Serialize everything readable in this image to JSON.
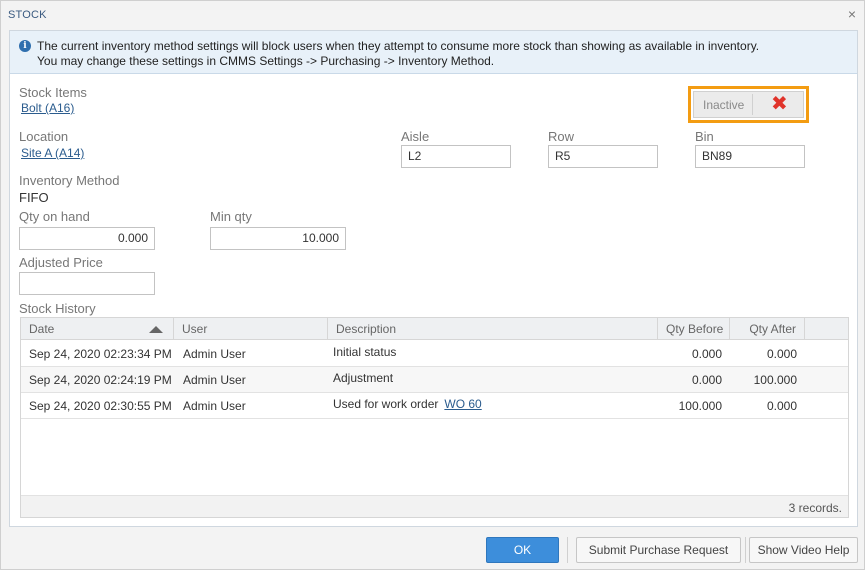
{
  "dialog": {
    "title": "STOCK",
    "close_glyph": "×"
  },
  "info": {
    "icon": "info-icon",
    "line1": "The current inventory method settings will block users when they attempt to consume more stock than showing as available in inventory.",
    "line2": "You may change these settings in CMMS Settings -> Purchasing -> Inventory Method."
  },
  "form": {
    "stock_items_label": "Stock Items",
    "stock_item_value": "Bolt (A16)",
    "status_toggle_label": "Inactive",
    "status_toggle_icon": "✖",
    "location_label": "Location",
    "location_value": "Site A (A14)",
    "aisle_label": "Aisle",
    "aisle_value": "L2",
    "row_label": "Row",
    "row_value": "R5",
    "bin_label": "Bin",
    "bin_value": "BN89",
    "inventory_method_label": "Inventory Method",
    "inventory_method_value": "FIFO",
    "qty_on_hand_label": "Qty on hand",
    "qty_on_hand_value": "0.000",
    "min_qty_label": "Min qty",
    "min_qty_value": "10.000",
    "adjusted_price_label": "Adjusted Price",
    "adjusted_price_value": ""
  },
  "history": {
    "label": "Stock History",
    "columns": [
      "Date",
      "User",
      "Description",
      "Qty Before",
      "Qty After"
    ],
    "rows": [
      {
        "date": "Sep 24, 2020 02:23:34 PM",
        "user": "Admin User",
        "description": "Initial status",
        "link": "",
        "qty_before": "0.000",
        "qty_after": "0.000"
      },
      {
        "date": "Sep 24, 2020 02:24:19 PM",
        "user": "Admin User",
        "description": "Adjustment",
        "link": "",
        "qty_before": "0.000",
        "qty_after": "100.000"
      },
      {
        "date": "Sep 24, 2020 02:30:55 PM",
        "user": "Admin User",
        "description": "Used for work order",
        "link": "WO 60",
        "qty_before": "100.000",
        "qty_after": "0.000"
      }
    ],
    "records_text": "3 records."
  },
  "buttons": {
    "ok": "OK",
    "submit_purchase_request": "Submit Purchase Request",
    "show_video_help": "Show Video Help"
  },
  "colors": {
    "accent": "#3d8edb",
    "highlight_border": "#f39c12",
    "inactive_x": "#e0342b",
    "link": "#2b5c8e"
  }
}
